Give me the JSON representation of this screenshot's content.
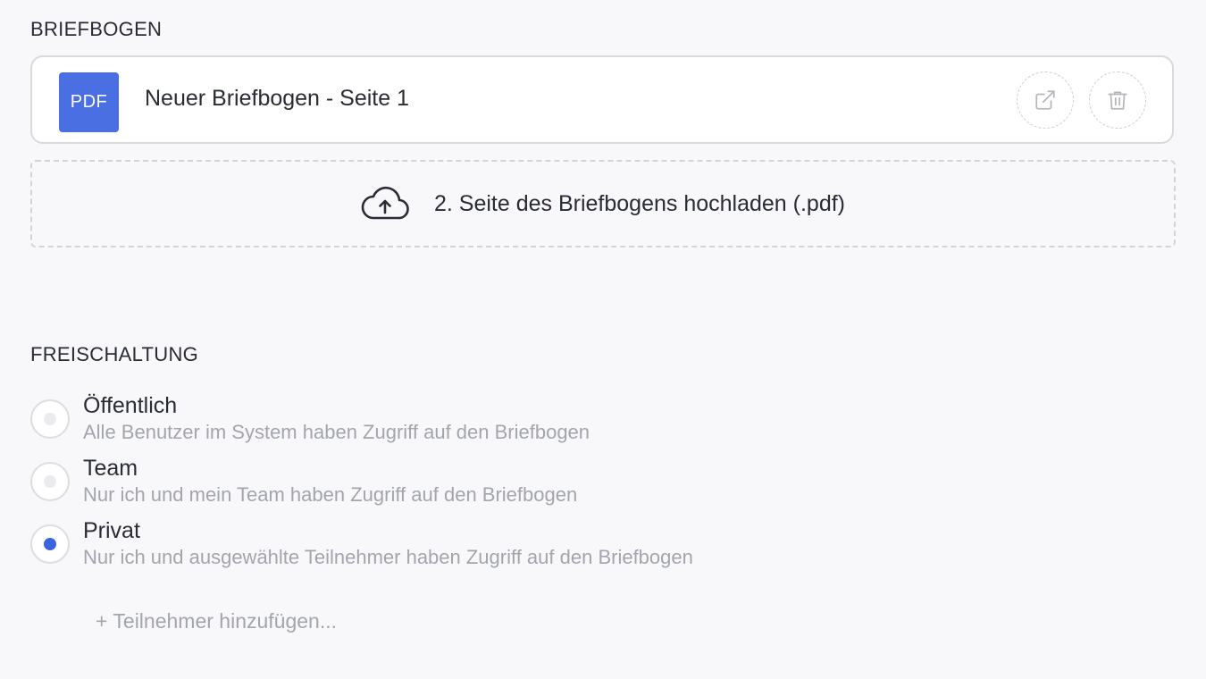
{
  "letterhead": {
    "section_title": "BRIEFBOGEN",
    "file": {
      "badge": "PDF",
      "name": "Neuer Briefbogen - Seite 1",
      "open_icon": "external-link-icon",
      "delete_icon": "trash-icon"
    },
    "upload": {
      "icon": "cloud-upload-icon",
      "label": "2. Seite des Briefbogens hochladen (.pdf)"
    }
  },
  "access": {
    "section_title": "FREISCHALTUNG",
    "options": [
      {
        "label": "Öffentlich",
        "description": "Alle Benutzer im System  haben Zugriff auf den Briefbogen",
        "selected": false
      },
      {
        "label": "Team",
        "description": "Nur ich und mein Team haben Zugriff auf den Briefbogen",
        "selected": false
      },
      {
        "label": "Privat",
        "description": "Nur ich und ausgewählte  Teilnehmer haben Zugriff auf den Briefbogen",
        "selected": true
      }
    ],
    "add_participant_label": "+ Teilnehmer hinzufügen..."
  },
  "colors": {
    "accent": "#3b64e0",
    "pdf_badge": "#4a6fe3",
    "background": "#f8f8fa",
    "muted_text": "#a3a5ad"
  }
}
